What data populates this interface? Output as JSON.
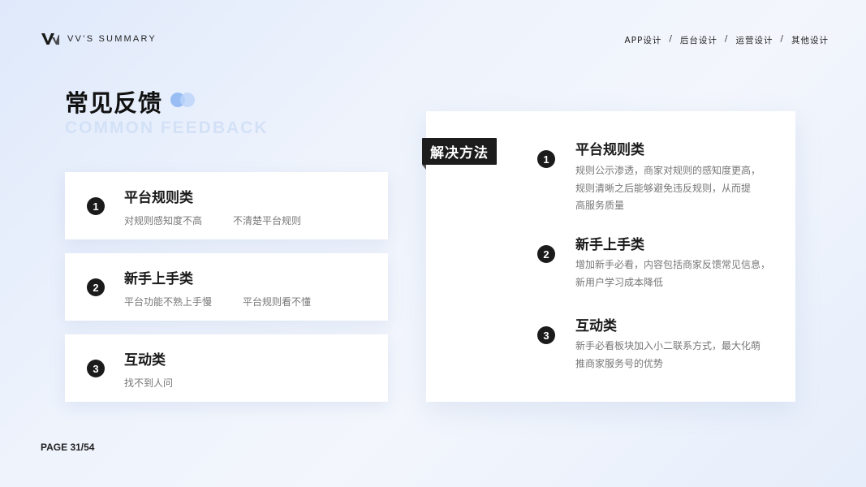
{
  "header": {
    "brand": "VV’S SUMMARY",
    "nav": [
      "APP设计",
      "后台设计",
      "运营设计",
      "其他设计"
    ],
    "nav_separator": "/"
  },
  "title": {
    "main": "常见反馈",
    "sub": "COMMON FEEDBACK"
  },
  "feedback_cards": [
    {
      "number": "1",
      "title": "平台规则类",
      "tags": [
        "对规则感知度不高",
        "不清楚平台规则"
      ]
    },
    {
      "number": "2",
      "title": "新手上手类",
      "tags": [
        "平台功能不熟上手慢",
        "平台规则看不懂"
      ]
    },
    {
      "number": "3",
      "title": "互动类",
      "tags": [
        "找不到人问"
      ]
    }
  ],
  "solution": {
    "tab_label": "解决方法",
    "items": [
      {
        "number": "1",
        "title": "平台规则类",
        "lines": [
          "规则公示渗透，商家对规则的感知度更高，",
          "规则清晰之后能够避免违反规则，从而提",
          "高服务质量"
        ]
      },
      {
        "number": "2",
        "title": "新手上手类",
        "lines": [
          "增加新手必看，内容包括商家反馈常见信息，",
          "新用户学习成本降低"
        ]
      },
      {
        "number": "3",
        "title": "互动类",
        "lines": [
          "新手必看板块加入小二联系方式，最大化萌",
          "推商家服务号的优势"
        ]
      }
    ]
  },
  "footer": {
    "page": "PAGE 31/54"
  },
  "colors": {
    "accent": "#98bdf5",
    "subtitle": "#d3e1f7",
    "dark": "#1c1c1c"
  }
}
